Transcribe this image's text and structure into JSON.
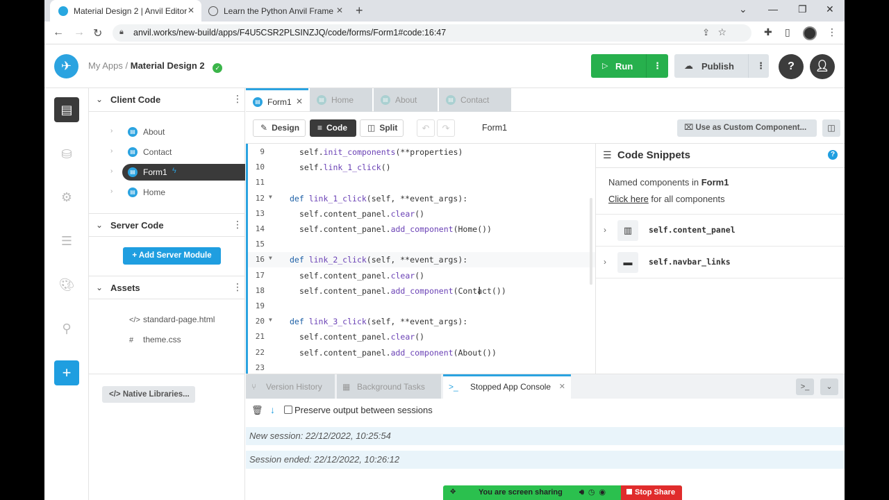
{
  "browser": {
    "tabs": [
      {
        "title": "Material Design 2 | Anvil Editor",
        "active": true
      },
      {
        "title": "Learn the Python Anvil Framewo",
        "active": false
      }
    ],
    "url": "anvil.works/new-build/apps/F4U5CSR2PLSINZJQ/code/forms/Form1#code:16:47"
  },
  "header": {
    "breadcrumb_root": "My Apps",
    "breadcrumb_sep": "/",
    "app_name": "Material Design 2",
    "run_label": "Run",
    "publish_label": "Publish"
  },
  "sidebar": {
    "client_code_title": "Client Code",
    "client_items": [
      {
        "label": "About"
      },
      {
        "label": "Contact"
      },
      {
        "label": "Form1",
        "selected": true
      },
      {
        "label": "Home"
      }
    ],
    "server_code_title": "Server Code",
    "add_server_label": "Add Server Module",
    "assets_title": "Assets",
    "assets": [
      {
        "symbol": "</>",
        "label": "standard-page.html"
      },
      {
        "symbol": "#",
        "label": "theme.css"
      }
    ],
    "native_libs_label": "Native Libraries..."
  },
  "editor": {
    "tabs": [
      {
        "label": "Form1",
        "active": true
      },
      {
        "label": "Home"
      },
      {
        "label": "About"
      },
      {
        "label": "Contact"
      }
    ],
    "toolbar": {
      "design_label": "Design",
      "code_label": "Code",
      "split_label": "Split",
      "form_title": "Form1",
      "custom_component_label": "Use as Custom Component..."
    },
    "code_lines": [
      {
        "n": "9",
        "indent": 2,
        "segments": [
          [
            "",
            "self."
          ],
          [
            "fn",
            "init_components"
          ],
          [
            "",
            "(**properties)"
          ]
        ]
      },
      {
        "n": "10",
        "indent": 2,
        "segments": [
          [
            "",
            "self."
          ],
          [
            "fn",
            "link_1_click"
          ],
          [
            "",
            "()"
          ]
        ]
      },
      {
        "n": "11",
        "indent": 0,
        "segments": []
      },
      {
        "n": "12",
        "indent": 1,
        "fold": true,
        "segments": [
          [
            "kw",
            "def "
          ],
          [
            "fn",
            "link_1_click"
          ],
          [
            "",
            "(self, **event_args):"
          ]
        ]
      },
      {
        "n": "13",
        "indent": 2,
        "segments": [
          [
            "",
            "self.content_panel."
          ],
          [
            "fn",
            "clear"
          ],
          [
            "",
            "()"
          ]
        ]
      },
      {
        "n": "14",
        "indent": 2,
        "segments": [
          [
            "",
            "self.content_panel."
          ],
          [
            "fn",
            "add_component"
          ],
          [
            "",
            "(Home())"
          ]
        ]
      },
      {
        "n": "15",
        "indent": 0,
        "segments": []
      },
      {
        "n": "16",
        "indent": 1,
        "fold": true,
        "hl": true,
        "segments": [
          [
            "kw",
            "def "
          ],
          [
            "fn",
            "link_2_click"
          ],
          [
            "",
            "(self, **event_args):"
          ]
        ]
      },
      {
        "n": "17",
        "indent": 2,
        "segments": [
          [
            "",
            "self.content_panel."
          ],
          [
            "fn",
            "clear"
          ],
          [
            "",
            "()"
          ]
        ]
      },
      {
        "n": "18",
        "indent": 2,
        "segments": [
          [
            "",
            "self.content_panel."
          ],
          [
            "fn",
            "add_component"
          ],
          [
            "",
            "(Contact())"
          ]
        ]
      },
      {
        "n": "19",
        "indent": 0,
        "segments": []
      },
      {
        "n": "20",
        "indent": 1,
        "fold": true,
        "segments": [
          [
            "kw",
            "def "
          ],
          [
            "fn",
            "link_3_click"
          ],
          [
            "",
            "(self, **event_args):"
          ]
        ]
      },
      {
        "n": "21",
        "indent": 2,
        "segments": [
          [
            "",
            "self.content_panel."
          ],
          [
            "fn",
            "clear"
          ],
          [
            "",
            "()"
          ]
        ]
      },
      {
        "n": "22",
        "indent": 2,
        "segments": [
          [
            "",
            "self.content_panel."
          ],
          [
            "fn",
            "add_component"
          ],
          [
            "",
            "(About())"
          ]
        ]
      },
      {
        "n": "23",
        "indent": 0,
        "segments": []
      }
    ]
  },
  "snippets": {
    "title": "Code Snippets",
    "named_prefix": "Named components in",
    "form_name": "Form1",
    "click_here": "Click here",
    "click_suffix": "for all components",
    "items": [
      {
        "name": "self.content_panel"
      },
      {
        "name": "self.navbar_links"
      }
    ]
  },
  "bottom": {
    "tabs": [
      {
        "label": "Version History"
      },
      {
        "label": "Background Tasks"
      },
      {
        "label": "Stopped App Console",
        "active": true
      }
    ],
    "preserve_label": "Preserve output between sessions",
    "sessions": [
      {
        "text": "New session: 22/12/2022, 10:25:54"
      },
      {
        "text": "Session ended: 22/12/2022, 10:26:12"
      }
    ]
  },
  "share_bar": {
    "message": "You are screen sharing",
    "stop_label": "Stop Share"
  }
}
